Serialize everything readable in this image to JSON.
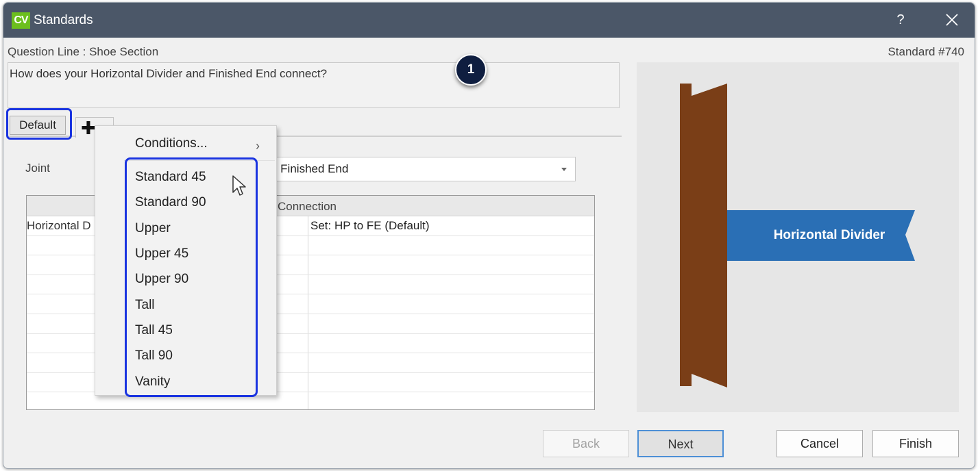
{
  "window": {
    "logo": "CV",
    "title": "Standards",
    "help": "?"
  },
  "header": {
    "question_line": "Question Line : Shoe Section",
    "standard_number": "Standard #740"
  },
  "question": {
    "text": "How does your Horizontal Divider and Finished End connect?"
  },
  "annotation": {
    "step": "1"
  },
  "tabs": {
    "default_label": "Default",
    "add_icon": "plus-icon"
  },
  "joint": {
    "label": "Joint",
    "selected_value": "o Finished End"
  },
  "grid": {
    "header_col2": "Connection",
    "rows": [
      {
        "part": "Horizontal D",
        "connection": "Set: HP to FE (Default)"
      }
    ]
  },
  "preview": {
    "label": "Horizontal Divider",
    "colors": {
      "finished_end": "#7a3e17",
      "divider": "#2a6fb5",
      "background": "#e6e6e6"
    }
  },
  "context_menu": {
    "conditions_label": "Conditions...",
    "items": [
      "Standard 45",
      "Standard 90",
      "Upper",
      "Upper 45",
      "Upper 90",
      "Tall",
      "Tall 45",
      "Tall 90",
      "Vanity"
    ]
  },
  "buttons": {
    "back": "Back",
    "next": "Next",
    "cancel": "Cancel",
    "finish": "Finish"
  },
  "colors": {
    "titlebar": "#4b5768",
    "logo": "#6cbf1e",
    "highlight": "#1a34e0"
  }
}
